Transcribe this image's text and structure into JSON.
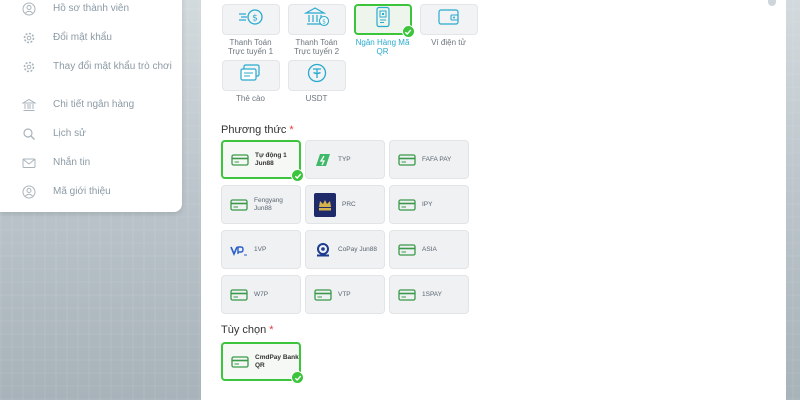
{
  "sidebar": {
    "items": [
      {
        "label": "Hồ sơ thành viên",
        "icon": "user-icon"
      },
      {
        "label": "Đổi mật khẩu",
        "icon": "gear-icon"
      },
      {
        "label": "Thay đổi mật khẩu trò chơi",
        "icon": "gear-icon"
      },
      {
        "label": "Chi tiết ngân hàng",
        "icon": "bank-icon"
      },
      {
        "label": "Lịch sử",
        "icon": "search-icon"
      },
      {
        "label": "Nhắn tin",
        "icon": "mail-icon"
      },
      {
        "label": "Mã giới thiệu",
        "icon": "user-plus-icon"
      }
    ]
  },
  "methods": [
    {
      "label": "Thanh Toán Trực tuyến 1",
      "icon": "online-payment-icon",
      "selected": false
    },
    {
      "label": "Thanh Toán Trực tuyến 2",
      "icon": "bank-payment-icon",
      "selected": false
    },
    {
      "label": "Ngân Hàng Mã QR",
      "icon": "qr-bank-icon",
      "selected": true
    },
    {
      "label": "Ví điện tử",
      "icon": "wallet-icon",
      "selected": false
    },
    {
      "label": "Thẻ cào",
      "icon": "scratch-card-icon",
      "selected": false
    },
    {
      "label": "USDT",
      "icon": "usdt-icon",
      "selected": false
    }
  ],
  "phuong_thuc": {
    "title": "Phương thức",
    "required": "*",
    "providers": [
      {
        "name": "Tự động 1 Jun88",
        "icon": "card-icon",
        "selected": true
      },
      {
        "name": "TYP",
        "icon": "typ-logo-icon",
        "selected": false
      },
      {
        "name": "FAFA PAY",
        "icon": "card-icon",
        "selected": false
      },
      {
        "name": "Fengyang Jun88",
        "icon": "card-icon",
        "selected": false
      },
      {
        "name": "PRC",
        "icon": "prince-logo-icon",
        "selected": false
      },
      {
        "name": "IPY",
        "icon": "card-icon",
        "selected": false
      },
      {
        "name": "1VP",
        "icon": "1vp-logo-icon",
        "selected": false
      },
      {
        "name": "CoPay Jun88",
        "icon": "copay-logo-icon",
        "selected": false
      },
      {
        "name": "ASIA",
        "icon": "card-icon",
        "selected": false
      },
      {
        "name": "W7P",
        "icon": "card-icon",
        "selected": false
      },
      {
        "name": "VTP",
        "icon": "card-icon",
        "selected": false
      },
      {
        "name": "1SPAY",
        "icon": "card-icon",
        "selected": false
      }
    ]
  },
  "tuy_chon": {
    "title": "Tùy chọn",
    "required": "*",
    "providers": [
      {
        "name": "CmdPay Bank QR",
        "icon": "card-icon",
        "selected": true
      }
    ]
  },
  "colors": {
    "accent": "#3cc53c",
    "selected_text": "#29aacf",
    "required": "#e03c3c"
  }
}
